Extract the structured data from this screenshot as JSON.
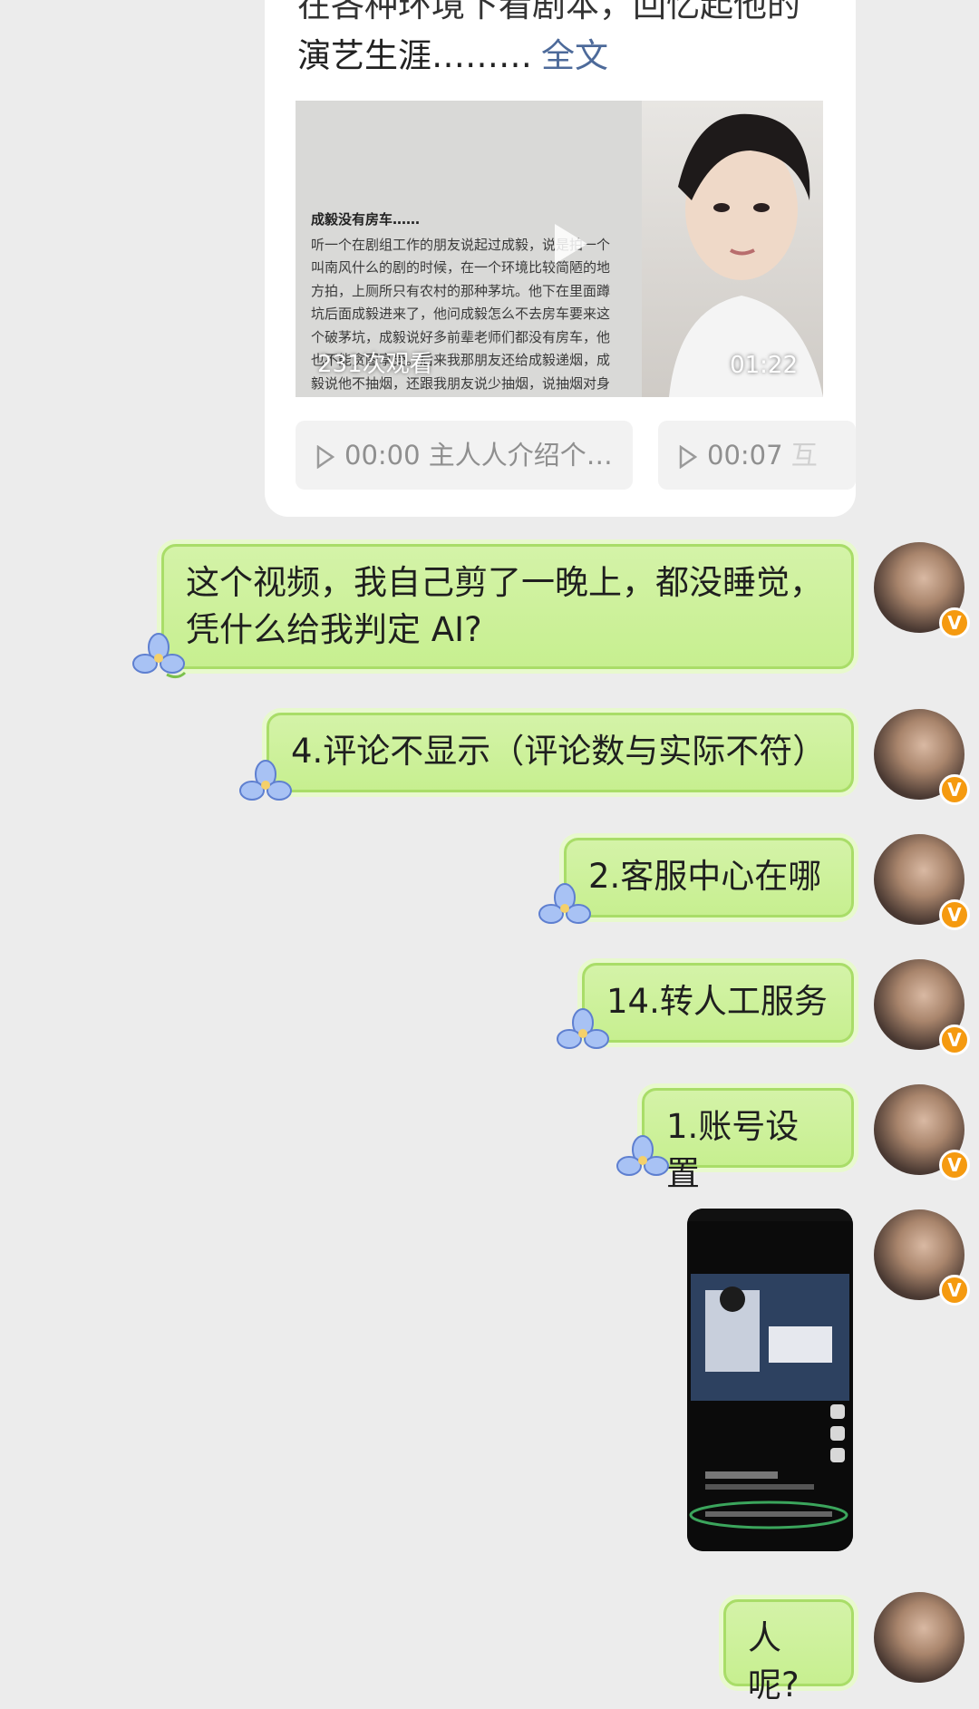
{
  "card": {
    "line_partial": "在各种环境下看剧本，回忆起他的",
    "line2": "演艺生涯………",
    "more_link": "全文",
    "video": {
      "title": "成毅没有房车……",
      "body": "听一个在剧组工作的朋友说起过成毅，说是拍一个\n叫南风什么的剧的时候，在一个环境比较简陋的地\n方拍，上厕所只有农村的那种茅坑。他下在里面蹲\n坑后面成毅进来了，他问成毅怎么不去房车要来这\n个破茅坑，成毅说好多前辈老师们都没有房车，他\n也不能贪图享受。后来我那朋友还给成毅递烟，成\n毅说他不抽烟，还跟我朋友说少抽烟，说抽烟对身\n体不好。没想到私底下居然是个憨憨帅哥，很难\n不对他有好感",
      "views": "231次观看",
      "duration": "01:22"
    },
    "chips": [
      {
        "time": "00:00",
        "text": "主人人介绍个…"
      },
      {
        "time": "00:07",
        "text": "互"
      }
    ]
  },
  "messages": [
    {
      "text": "这个视频，我自己剪了一晚上，都没睡觉，凭什么给我判定 AI?"
    },
    {
      "text": "4.评论不显示（评论数与实际不符）"
    },
    {
      "text": "2.客服中心在哪"
    },
    {
      "text": "14.转人工服务"
    },
    {
      "text": "1.账号设置"
    },
    {
      "text": "人呢?"
    }
  ],
  "avatar_badge": "V",
  "colors": {
    "background": "#ececec",
    "bubble": "#c9f09a",
    "bubble_border": "#a9dd68",
    "link": "#4d6a9a",
    "badge": "#f59a10"
  }
}
